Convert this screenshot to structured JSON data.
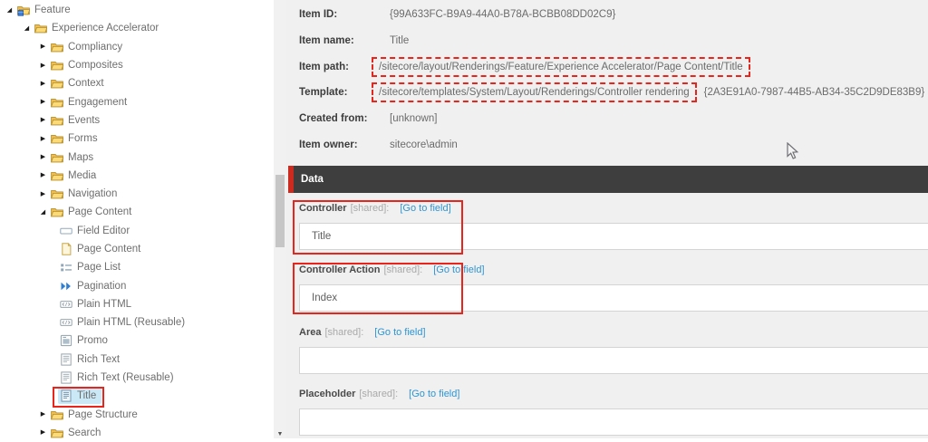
{
  "tree": {
    "items": [
      {
        "label": "Feature",
        "level": 0,
        "icon": "feature-folder",
        "state": "expanded"
      },
      {
        "label": "Experience Accelerator",
        "level": 1,
        "icon": "folder",
        "state": "expanded"
      },
      {
        "label": "Compliancy",
        "level": 2,
        "icon": "folder",
        "state": "collapsed"
      },
      {
        "label": "Composites",
        "level": 2,
        "icon": "folder",
        "state": "collapsed"
      },
      {
        "label": "Context",
        "level": 2,
        "icon": "folder",
        "state": "collapsed"
      },
      {
        "label": "Engagement",
        "level": 2,
        "icon": "folder",
        "state": "collapsed"
      },
      {
        "label": "Events",
        "level": 2,
        "icon": "folder",
        "state": "collapsed"
      },
      {
        "label": "Forms",
        "level": 2,
        "icon": "folder",
        "state": "collapsed"
      },
      {
        "label": "Maps",
        "level": 2,
        "icon": "folder",
        "state": "collapsed"
      },
      {
        "label": "Media",
        "level": 2,
        "icon": "folder",
        "state": "collapsed"
      },
      {
        "label": "Navigation",
        "level": 2,
        "icon": "folder",
        "state": "collapsed"
      },
      {
        "label": "Page Content",
        "level": 2,
        "icon": "folder",
        "state": "expanded"
      },
      {
        "label": "Field Editor",
        "level": 3,
        "icon": "field-editor",
        "state": "none"
      },
      {
        "label": "Page Content",
        "level": 3,
        "icon": "page-content",
        "state": "none"
      },
      {
        "label": "Page List",
        "level": 3,
        "icon": "page-list",
        "state": "none"
      },
      {
        "label": "Pagination",
        "level": 3,
        "icon": "pagination",
        "state": "none"
      },
      {
        "label": "Plain HTML",
        "level": 3,
        "icon": "plain-html",
        "state": "none"
      },
      {
        "label": "Plain HTML (Reusable)",
        "level": 3,
        "icon": "plain-html",
        "state": "none"
      },
      {
        "label": "Promo",
        "level": 3,
        "icon": "promo",
        "state": "none"
      },
      {
        "label": "Rich Text",
        "level": 3,
        "icon": "rich-text",
        "state": "none"
      },
      {
        "label": "Rich Text (Reusable)",
        "level": 3,
        "icon": "rich-text",
        "state": "none"
      },
      {
        "label": "Title",
        "level": 3,
        "icon": "title",
        "state": "none",
        "selected": true
      },
      {
        "label": "Page Structure",
        "level": 2,
        "icon": "folder",
        "state": "collapsed"
      },
      {
        "label": "Search",
        "level": 2,
        "icon": "folder",
        "state": "collapsed"
      }
    ]
  },
  "details": {
    "rows": [
      {
        "label": "Item ID:",
        "value": "{99A633FC-B9A9-44A0-B78A-BCBB08DD02C9}"
      },
      {
        "label": "Item name:",
        "value": "Title"
      },
      {
        "label": "Item path:",
        "value": "/sitecore/layout/Renderings/Feature/Experience Accelerator/Page Content/Title",
        "annotated": "dashed"
      },
      {
        "label": "Template:",
        "value": "/sitecore/templates/System/Layout/Renderings/Controller rendering",
        "annotated": "dashed",
        "suffix": "{2A3E91A0-7987-44B5-AB34-35C2D9DE83B9}"
      },
      {
        "label": "Created from:",
        "value": "[unknown]"
      },
      {
        "label": "Item owner:",
        "value": "sitecore\\admin"
      }
    ]
  },
  "data_section": {
    "title": "Data",
    "fields": [
      {
        "name": "Controller",
        "shared": "[shared]:",
        "link": "[Go to field]",
        "value": "Title"
      },
      {
        "name": "Controller Action",
        "shared": "[shared]:",
        "link": "[Go to field]",
        "value": "Index"
      },
      {
        "name": "Area",
        "shared": "[shared]:",
        "link": "[Go to field]",
        "value": ""
      },
      {
        "name": "Placeholder",
        "shared": "[shared]:",
        "link": "[Go to field]",
        "value": ""
      }
    ]
  },
  "colors": {
    "annotation_red": "#e8251c",
    "data_header_bg": "#3e3e3e",
    "data_header_accent": "#cc2a1e",
    "selection_blue": "#cbe8f6",
    "link_blue": "#2e95d3",
    "panel_bg": "#f0f0f0",
    "folder_yellow": "#f6ce63"
  }
}
